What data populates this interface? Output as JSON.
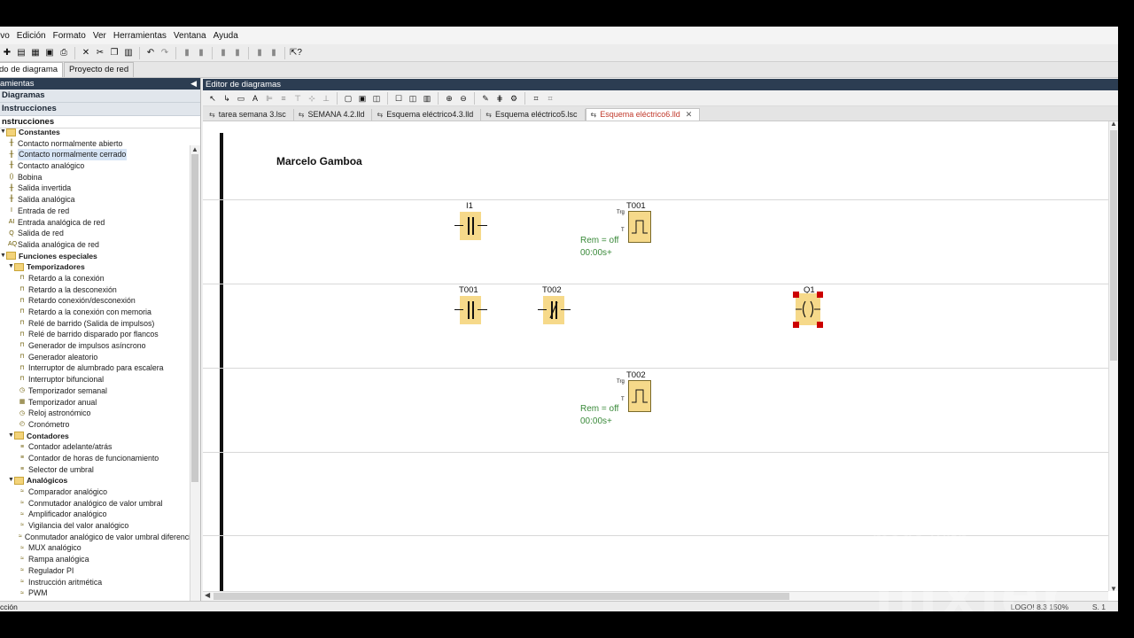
{
  "menu": [
    "ivo",
    "Edición",
    "Formato",
    "Ver",
    "Herramientas",
    "Ventana",
    "Ayuda"
  ],
  "main_tabs": {
    "diagram": "do de diagrama",
    "network": "Proyecto de red"
  },
  "left_panel": {
    "title": "amientas",
    "section_diagrams": "Diagramas",
    "section_instructions": "Instrucciones",
    "instructions_root": "nstrucciones",
    "tree": [
      {
        "label": "Constantes",
        "level": 0,
        "folder": true
      },
      {
        "label": "Contacto normalmente abierto",
        "level": 1,
        "icon": "contact-no-icon"
      },
      {
        "label": "Contacto normalmente cerrado",
        "level": 1,
        "icon": "contact-nc-icon",
        "selected": true
      },
      {
        "label": "Contacto analógico",
        "level": 1,
        "icon": "analog-contact-icon"
      },
      {
        "label": "Bobina",
        "level": 1,
        "icon": "coil-icon"
      },
      {
        "label": "Salida invertida",
        "level": 1,
        "icon": "inverted-output-icon"
      },
      {
        "label": "Salida analógica",
        "level": 1,
        "icon": "analog-output-icon"
      },
      {
        "label": "Entrada de red",
        "level": 1,
        "icon": "network-input-icon"
      },
      {
        "label": "Entrada analógica de red",
        "level": 1,
        "icon": "analog-network-input-icon"
      },
      {
        "label": "Salida de red",
        "level": 1,
        "icon": "network-output-icon"
      },
      {
        "label": "Salida analógica de red",
        "level": 1,
        "icon": "analog-network-output-icon"
      },
      {
        "label": "Funciones especiales",
        "level": 0,
        "folder": true
      },
      {
        "label": "Temporizadores",
        "level": 1,
        "folder": true
      },
      {
        "label": "Retardo a la conexión",
        "level": 2,
        "icon": "timer-icon"
      },
      {
        "label": "Retardo a la desconexión",
        "level": 2,
        "icon": "timer-icon"
      },
      {
        "label": "Retardo conexión/desconexión",
        "level": 2,
        "icon": "timer-icon"
      },
      {
        "label": "Retardo a la conexión con memoria",
        "level": 2,
        "icon": "timer-icon"
      },
      {
        "label": "Relé de barrido (Salida de impulsos)",
        "level": 2,
        "icon": "timer-icon"
      },
      {
        "label": "Relé de barrido disparado por flancos",
        "level": 2,
        "icon": "timer-icon"
      },
      {
        "label": "Generador de impulsos asíncrono",
        "level": 2,
        "icon": "timer-icon"
      },
      {
        "label": "Generador aleatorio",
        "level": 2,
        "icon": "timer-icon"
      },
      {
        "label": "Interruptor de alumbrado para escalera",
        "level": 2,
        "icon": "timer-icon"
      },
      {
        "label": "Interruptor bifuncional",
        "level": 2,
        "icon": "timer-icon"
      },
      {
        "label": "Temporizador semanal",
        "level": 2,
        "icon": "clock-icon"
      },
      {
        "label": "Temporizador anual",
        "level": 2,
        "icon": "calendar-icon"
      },
      {
        "label": "Reloj astronómico",
        "level": 2,
        "icon": "clock-icon"
      },
      {
        "label": "Cronómetro",
        "level": 2,
        "icon": "stopwatch-icon"
      },
      {
        "label": "Contadores",
        "level": 1,
        "folder": true
      },
      {
        "label": "Contador adelante/atrás",
        "level": 2,
        "icon": "counter-icon"
      },
      {
        "label": "Contador de horas de funcionamiento",
        "level": 2,
        "icon": "counter-icon"
      },
      {
        "label": "Selector de umbral",
        "level": 2,
        "icon": "counter-icon"
      },
      {
        "label": "Analógicos",
        "level": 1,
        "folder": true
      },
      {
        "label": "Comparador analógico",
        "level": 2,
        "icon": "analog-icon"
      },
      {
        "label": "Conmutador analógico de valor umbral",
        "level": 2,
        "icon": "analog-icon"
      },
      {
        "label": "Amplificador analógico",
        "level": 2,
        "icon": "analog-icon"
      },
      {
        "label": "Vigilancia del valor analógico",
        "level": 2,
        "icon": "analog-icon"
      },
      {
        "label": "Conmutador analógico de valor umbral diferencial",
        "level": 2,
        "icon": "analog-icon"
      },
      {
        "label": "MUX analógico",
        "level": 2,
        "icon": "analog-icon"
      },
      {
        "label": "Rampa analógica",
        "level": 2,
        "icon": "analog-icon"
      },
      {
        "label": "Regulador PI",
        "level": 2,
        "icon": "analog-icon"
      },
      {
        "label": "Instrucción aritmética",
        "level": 2,
        "icon": "analog-icon"
      },
      {
        "label": "PWM",
        "level": 2,
        "icon": "analog-icon"
      }
    ]
  },
  "editor": {
    "title": "Editor de diagramas",
    "tabs": [
      {
        "label": "tarea semana 3.lsc",
        "active": false
      },
      {
        "label": "SEMANA 4.2.lld",
        "active": false
      },
      {
        "label": "Esquema eléctrico4.3.lld",
        "active": false
      },
      {
        "label": "Esquema eléctrico5.lsc",
        "active": false
      },
      {
        "label": "Esquema eléctrico6.lld",
        "active": true
      }
    ],
    "author": "Marcelo Gamboa",
    "elements": {
      "i1": "I1",
      "t001_timer": "T001",
      "t001_trg": "Trg",
      "t001_t": "T",
      "t001_rem": "Rem = off",
      "t001_time": "00:00s+",
      "t001_contact": "T001",
      "t002_contact": "T002",
      "q1": "Q1",
      "t002_timer": "T002",
      "t002_trg": "Trg",
      "t002_t": "T",
      "t002_rem": "Rem = off",
      "t002_time": "00:00s+"
    }
  },
  "status": {
    "left": "cción",
    "zoom": "LOGO! 8.3 150%",
    "page": "S. 1"
  },
  "watermark": {
    "line1": "made with",
    "line2": "flixier"
  },
  "colors": {
    "panel_title": "#2c3d52",
    "element_fill": "#f6d98a",
    "rem_text": "#3a8a3a",
    "active_tab": "#c0392b",
    "selection_handle": "#cc0000"
  }
}
